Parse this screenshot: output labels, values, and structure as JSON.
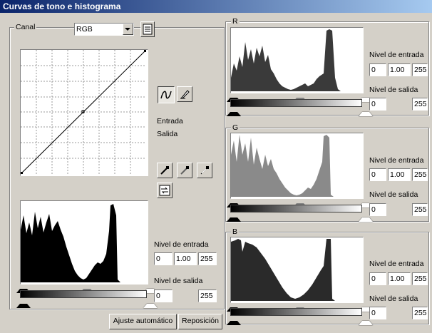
{
  "window": {
    "title": "Curvas de tono e histograma"
  },
  "channel": {
    "label": "Canal",
    "value": "RGB"
  },
  "curve": {
    "entrada_label": "Entrada",
    "salida_label": "Salida"
  },
  "main_levels": {
    "input_label": "Nivel de entrada",
    "input_black": "0",
    "input_gamma": "1.00",
    "input_white": "255",
    "output_label": "Nivel de salida",
    "output_black": "0",
    "output_white": "255"
  },
  "buttons": {
    "auto": "Ajuste automático",
    "reset": "Reposición"
  },
  "channels": [
    {
      "name": "R",
      "color": "#3a3a3a",
      "input_label": "Nivel de entrada",
      "input_black": "0",
      "input_gamma": "1.00",
      "input_white": "255",
      "output_label": "Nivel de salida",
      "output_black": "0",
      "output_white": "255"
    },
    {
      "name": "G",
      "color": "#8a8a8a",
      "input_label": "Nivel de entrada",
      "input_black": "0",
      "input_gamma": "1.00",
      "input_white": "255",
      "output_label": "Nivel de salida",
      "output_black": "0",
      "output_white": "255"
    },
    {
      "name": "B",
      "color": "#2a2a2a",
      "input_label": "Nivel de entrada",
      "input_black": "0",
      "input_gamma": "1.00",
      "input_white": "255",
      "output_label": "Nivel de salida",
      "output_black": "0",
      "output_white": "255"
    }
  ],
  "colors": {
    "titlebar": "#0a246a",
    "face": "#d4d0c8"
  }
}
